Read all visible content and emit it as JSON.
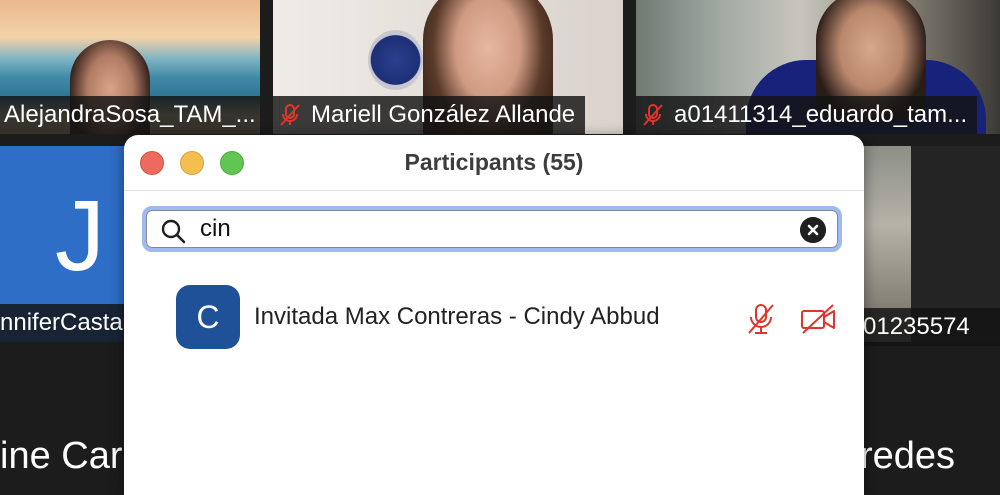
{
  "video_tiles": [
    {
      "name": "AlejandraSosa_TAM_..."
    },
    {
      "name": "Mariell González Allande"
    },
    {
      "name": "a01411314_eduardo_tam..."
    },
    {
      "name": "nniferCastañ",
      "initial": "J"
    },
    {
      "name": "01235574"
    }
  ],
  "background_names": {
    "left": "ine Caro",
    "right": "redes"
  },
  "panel": {
    "title": "Participants (55)",
    "search": {
      "value": "cin",
      "placeholder": ""
    },
    "participants": [
      {
        "initial": "C",
        "name": "Invitada Max Contreras - Cindy Abbud",
        "mic": "muted",
        "video": "off"
      }
    ]
  },
  "colors": {
    "accent_focus": "#9dbbf0",
    "avatar": "#1f5199",
    "muted_red": "#e0352b"
  },
  "icons": {
    "search": "search-icon",
    "clear": "clear-search-icon",
    "mic": "mic-off-icon",
    "video": "video-off-icon"
  }
}
